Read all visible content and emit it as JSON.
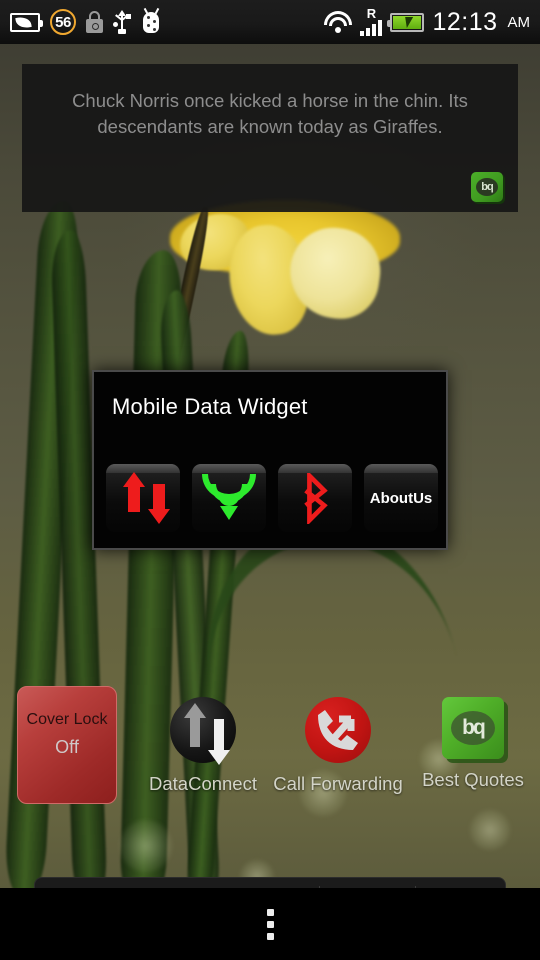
{
  "statusbar": {
    "left_icons": [
      {
        "name": "battery-saver-leaf-icon",
        "label": "battery-leaf"
      },
      {
        "name": "battery-percent-badge",
        "label": "56"
      },
      {
        "name": "screen-lock-icon",
        "label": "lock"
      },
      {
        "name": "usb-connected-icon",
        "label": "usb"
      },
      {
        "name": "adb-debug-icon",
        "label": "android-debug"
      }
    ],
    "battery_percent": "56",
    "roaming_indicator": "R",
    "signal_bars": 4,
    "time": "12:13",
    "ampm": "AM"
  },
  "quote_widget": {
    "text": "Chuck Norris once kicked a horse in the chin. Its descendants are known today as Giraffes.",
    "logo_label": "bq"
  },
  "dialog": {
    "title": "Mobile Data Widget",
    "buttons": [
      {
        "name": "mobile-data-toggle",
        "label": "",
        "icon": "data-transfer-arrows-icon",
        "color": "#ee1c1c"
      },
      {
        "name": "wifi-toggle",
        "label": "",
        "icon": "wifi-icon",
        "color": "#2dea2d"
      },
      {
        "name": "bluetooth-toggle",
        "label": "",
        "icon": "bluetooth-icon",
        "color": "#ee1c1c"
      },
      {
        "name": "about-us-button",
        "label": "AboutUs",
        "icon": "",
        "color": "#ffffff"
      }
    ]
  },
  "home": {
    "cover_lock": {
      "title": "Cover Lock",
      "state": "Off"
    },
    "icons": [
      {
        "name": "dataconnect-app-icon",
        "label": "DataConnect"
      },
      {
        "name": "call-forwarding-app-icon",
        "label": "Call Forwarding"
      },
      {
        "name": "best-quotes-app-icon",
        "label": "Best Quotes"
      }
    ]
  },
  "navbar": {
    "overflow_label": "menu"
  },
  "colors": {
    "accent_red": "#ee1c1c",
    "accent_green": "#2dea2d",
    "battery_badge": "#f0a830",
    "dialog_bg": "#030303",
    "widget_bg": "#161616"
  }
}
